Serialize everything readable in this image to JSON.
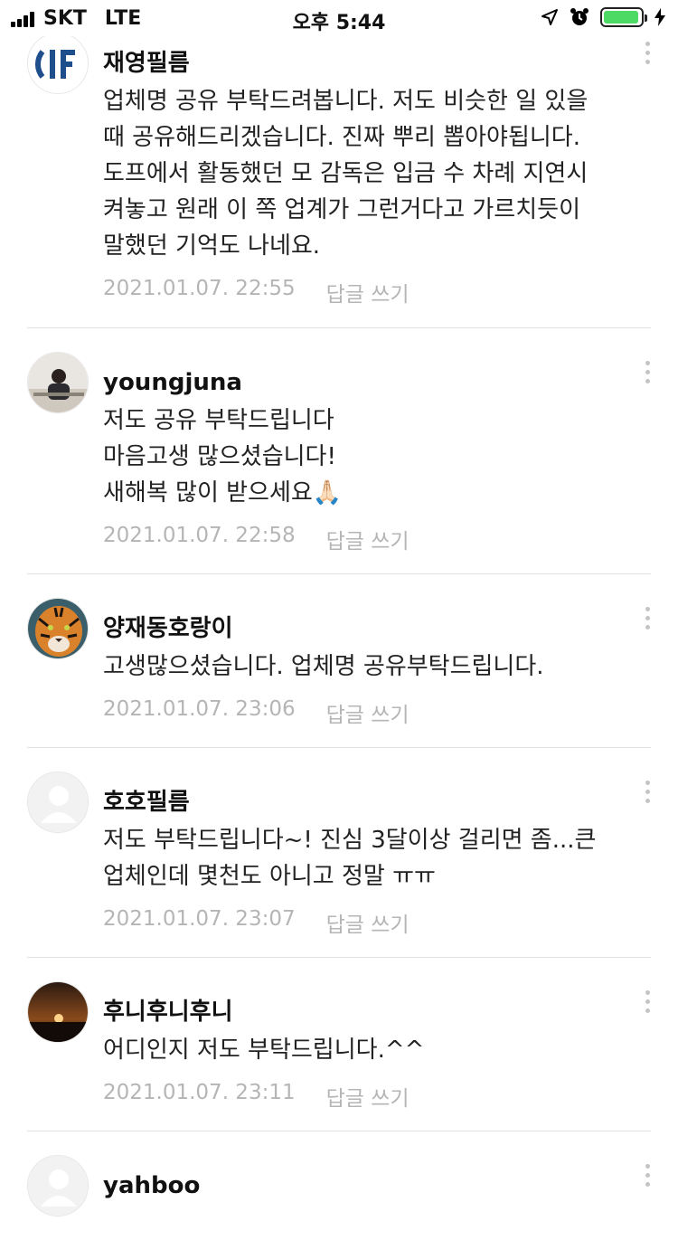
{
  "status_bar": {
    "carrier": "SKT",
    "network": "LTE",
    "time": "오후 5:44",
    "battery_level": 0.95,
    "battery_color": "#4cd964",
    "icons": [
      "signal-icon",
      "location-arrow-icon",
      "alarm-icon",
      "battery-icon",
      "charging-bolt-icon"
    ]
  },
  "comments": [
    {
      "author": "재영필름",
      "text": "업체명 공유 부탁드려봅니다. 저도 비슷한 일 있을\n때 공유해드리겠습니다. 진짜 뿌리 뽑아야됩니다.\n도프에서 활동했던 모 감독은 입금 수 차례 지연시\n켜놓고 원래 이 쪽 업계가 그런거다고 가르치듯이\n말했던 기억도 나네요.",
      "date": "2021.01.07. 22:55",
      "reply_label": "답글 쓰기",
      "avatar": "logo-avatar"
    },
    {
      "author": "youngjuna",
      "text": "저도 공유 부탁드립니다\n마음고생 많으셨습니다!\n새해복 많이 받으세요🙏🏻",
      "date": "2021.01.07. 22:58",
      "reply_label": "답글 쓰기",
      "avatar": "photo-avatar"
    },
    {
      "author": "양재동호랑이",
      "text": "고생많으셨습니다. 업체명 공유부탁드립니다.",
      "date": "2021.01.07. 23:06",
      "reply_label": "답글 쓰기",
      "avatar": "tiger-avatar"
    },
    {
      "author": "호호필름",
      "text": "저도 부탁드립니다~! 진심 3달이상 걸리면 좀...큰\n업체인데 몇천도 아니고 정말 ㅠㅠ",
      "date": "2021.01.07. 23:07",
      "reply_label": "답글 쓰기",
      "avatar": "default-avatar"
    },
    {
      "author": "후니후니후니",
      "text": "어디인지 저도 부탁드립니다.^^",
      "date": "2021.01.07. 23:11",
      "reply_label": "답글 쓰기",
      "avatar": "sunset-avatar"
    },
    {
      "author": "yahboo",
      "text": "",
      "date": "",
      "reply_label": "",
      "avatar": "default-avatar"
    }
  ]
}
